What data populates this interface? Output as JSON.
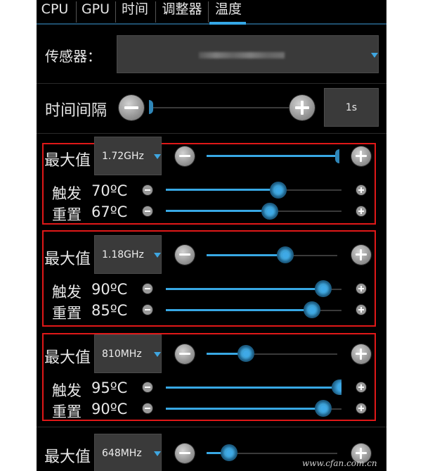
{
  "tabs": [
    "CPU",
    "GPU",
    "时间",
    "调整器",
    "温度"
  ],
  "active_tab": "温度",
  "sensor": {
    "label": "传感器：",
    "value": "",
    "note": "value blurred in screenshot"
  },
  "interval": {
    "label": "时间间隔",
    "value": "1s",
    "level": 0.0
  },
  "groups": [
    {
      "max_label": "最大值",
      "max_value": "1.72GHz",
      "max_level": 1.0,
      "highlighted": true,
      "trigger": {
        "label": "触发",
        "value": "70ºC",
        "level": 0.64
      },
      "reset": {
        "label": "重置",
        "value": "67ºC",
        "level": 0.59
      }
    },
    {
      "max_label": "最大值",
      "max_value": "1.18GHz",
      "max_level": 0.6,
      "highlighted": true,
      "trigger": {
        "label": "触发",
        "value": "90ºC",
        "level": 0.9
      },
      "reset": {
        "label": "重置",
        "value": "85ºC",
        "level": 0.83
      }
    },
    {
      "max_label": "最大值",
      "max_value": "810MHz",
      "max_level": 0.3,
      "highlighted": true,
      "trigger": {
        "label": "触发",
        "value": "95ºC",
        "level": 0.96
      },
      "reset": {
        "label": "重置",
        "value": "90ºC",
        "level": 0.9
      }
    },
    {
      "max_label": "最大值",
      "max_value": "648MHz",
      "max_level": 0.17,
      "highlighted": false
    }
  ],
  "watermark": "www.cfan.com.cn",
  "colors": {
    "accent": "#38a8e4",
    "highlight_border": "#e01818",
    "background": "#000000"
  }
}
